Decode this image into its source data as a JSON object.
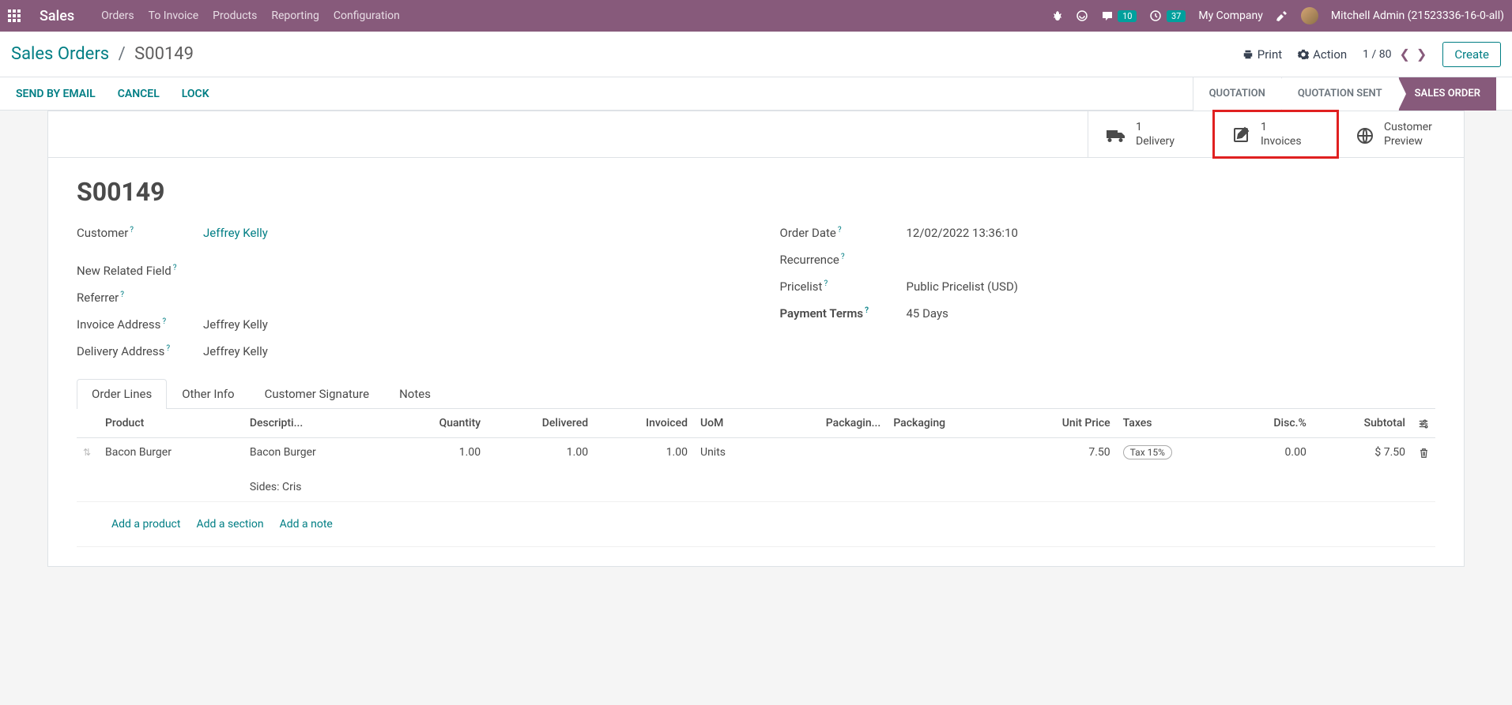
{
  "navbar": {
    "brand": "Sales",
    "menu": [
      "Orders",
      "To Invoice",
      "Products",
      "Reporting",
      "Configuration"
    ],
    "msg_count": "10",
    "clock_count": "37",
    "company": "My Company",
    "user": "Mitchell Admin (21523336-16-0-all)"
  },
  "breadcrumb": {
    "parent": "Sales Orders",
    "current": "S00149"
  },
  "controls": {
    "print": "Print",
    "action": "Action",
    "pager": "1 / 80",
    "create": "Create"
  },
  "actions": {
    "send": "SEND BY EMAIL",
    "cancel": "CANCEL",
    "lock": "LOCK"
  },
  "status": {
    "quotation": "QUOTATION",
    "sent": "QUOTATION SENT",
    "order": "SALES ORDER"
  },
  "stats": {
    "delivery_count": "1",
    "delivery_label": "Delivery",
    "invoice_count": "1",
    "invoice_label": "Invoices",
    "preview_l1": "Customer",
    "preview_l2": "Preview"
  },
  "record": {
    "title": "S00149",
    "labels": {
      "customer": "Customer",
      "new_field": "New Related Field",
      "referrer": "Referrer",
      "invoice_addr": "Invoice Address",
      "delivery_addr": "Delivery Address",
      "order_date": "Order Date",
      "recurrence": "Recurrence",
      "pricelist": "Pricelist",
      "payment_terms": "Payment Terms"
    },
    "values": {
      "customer": "Jeffrey Kelly",
      "invoice_addr": "Jeffrey Kelly",
      "delivery_addr": "Jeffrey Kelly",
      "order_date": "12/02/2022 13:36:10",
      "pricelist": "Public Pricelist (USD)",
      "payment_terms": "45 Days"
    }
  },
  "tabs": {
    "order_lines": "Order Lines",
    "other_info": "Other Info",
    "signature": "Customer Signature",
    "notes": "Notes"
  },
  "table": {
    "headers": {
      "product": "Product",
      "description": "Descripti...",
      "quantity": "Quantity",
      "delivered": "Delivered",
      "invoiced": "Invoiced",
      "uom": "UoM",
      "packaging_qty": "Packagin...",
      "packaging": "Packaging",
      "unit_price": "Unit Price",
      "taxes": "Taxes",
      "disc": "Disc.%",
      "subtotal": "Subtotal"
    },
    "row": {
      "product": "Bacon Burger",
      "description": "Bacon Burger",
      "description2": "Sides: Cris",
      "quantity": "1.00",
      "delivered": "1.00",
      "invoiced": "1.00",
      "uom": "Units",
      "unit_price": "7.50",
      "tax": "Tax 15%",
      "disc": "0.00",
      "subtotal": "$ 7.50"
    },
    "add": {
      "product": "Add a product",
      "section": "Add a section",
      "note": "Add a note"
    }
  }
}
